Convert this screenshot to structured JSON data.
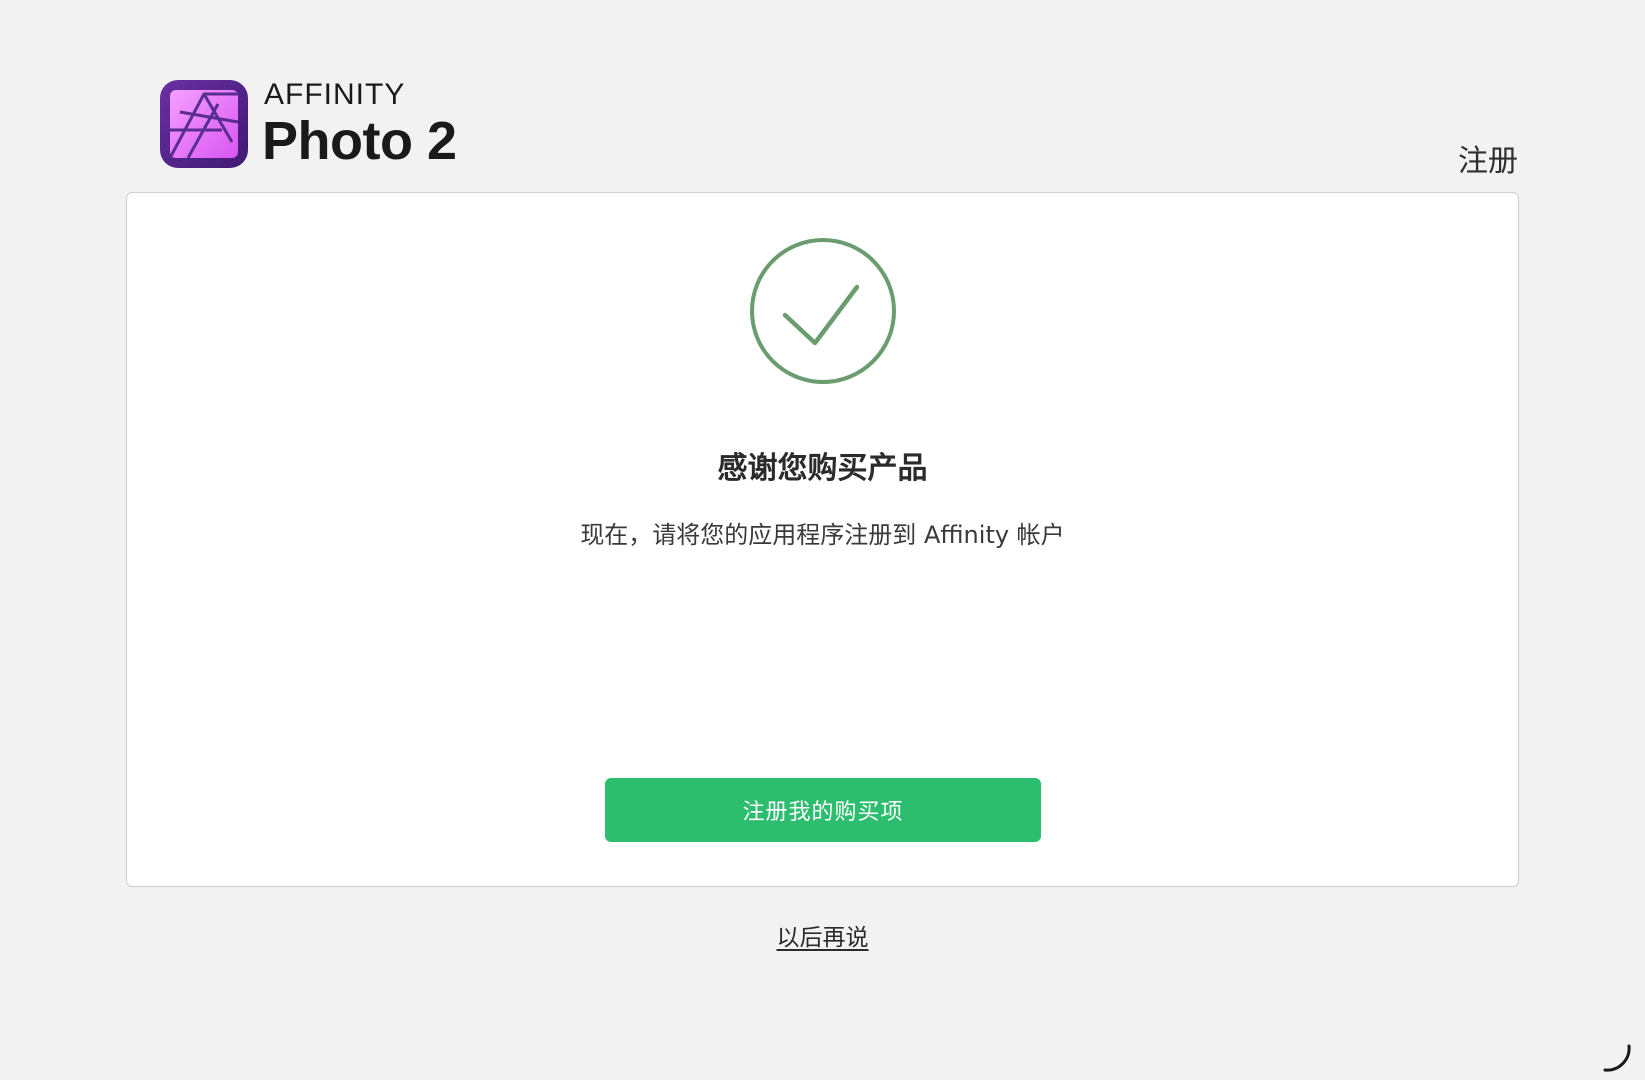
{
  "header": {
    "brand": "AFFINITY",
    "product": "Photo 2",
    "app_icon": "affinity-photo-app-icon",
    "step_label": "注册"
  },
  "card": {
    "icon": "checkmark-circle-icon",
    "title": "感谢您购买产品",
    "subtitle": "现在，请将您的应用程序注册到 Affinity 帐户",
    "primary_button_label": "注册我的购买项"
  },
  "footer": {
    "later_link": "以后再说",
    "loading_icon": "spinner-icon"
  },
  "colors": {
    "background": "#f2f2f2",
    "card": "#ffffff",
    "primary_button": "#2dbd6e",
    "checkmark": "#6b9c6f",
    "icon_purple_dark": "#5a2d91",
    "icon_purple_light": "#e879f9"
  }
}
